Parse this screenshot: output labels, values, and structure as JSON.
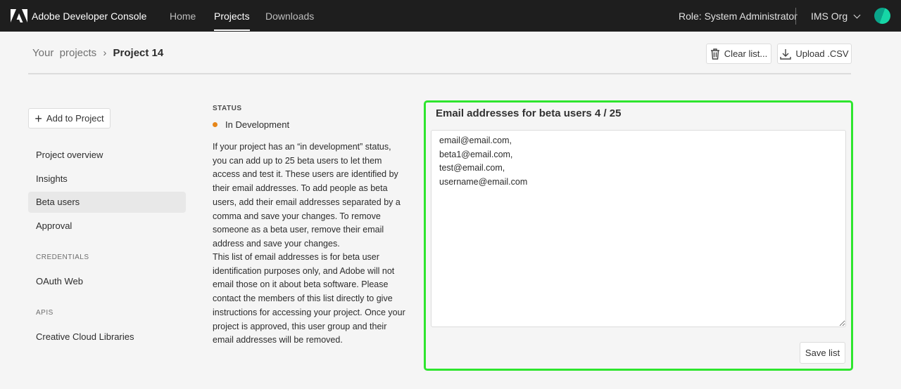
{
  "header": {
    "brand": "Adobe Developer Console",
    "nav": [
      "Home",
      "Projects",
      "Downloads"
    ],
    "active_nav": "Projects",
    "role": "Role: System Administrator",
    "org": "IMS Org"
  },
  "breadcrumb": {
    "parent": "Your  projects",
    "separator": "›",
    "current": "Project 14"
  },
  "toolbar": {
    "clear": "Clear list...",
    "upload": "Upload .CSV"
  },
  "sidebar": {
    "add": "Add to Project",
    "items": [
      "Project overview",
      "Insights",
      "Beta users",
      "Approval"
    ],
    "selected": "Beta users",
    "credentials_label": "CREDENTIALS",
    "credentials": [
      "OAuth Web"
    ],
    "apis_label": "APIS",
    "apis": [
      "Creative Cloud Libraries"
    ]
  },
  "status": {
    "label": "STATUS",
    "value": "In Development",
    "color": "#e68619"
  },
  "description": {
    "p1": "If your project has an “in development” status, you can add up to 25 beta users to let them access and test it. These users are identified by their email addresses. To add people as beta users, add their email addresses separated by a comma and save your changes. To remove someone as a beta user, remove their email address and save your changes.",
    "p2": "This list of email addresses is for beta user identification purposes only, and Adobe will not email those on it about beta software. Please contact the members of this list directly to give instructions for accessing your project. Once your project is approved, this user group and their email addresses will be removed."
  },
  "panel": {
    "title": "Email addresses for beta users 4 / 25",
    "emails": "email@email.com,\nbeta1@email.com,\ntest@email.com,\nusername@email.com",
    "save": "Save list",
    "highlight": "#2ee52e"
  }
}
